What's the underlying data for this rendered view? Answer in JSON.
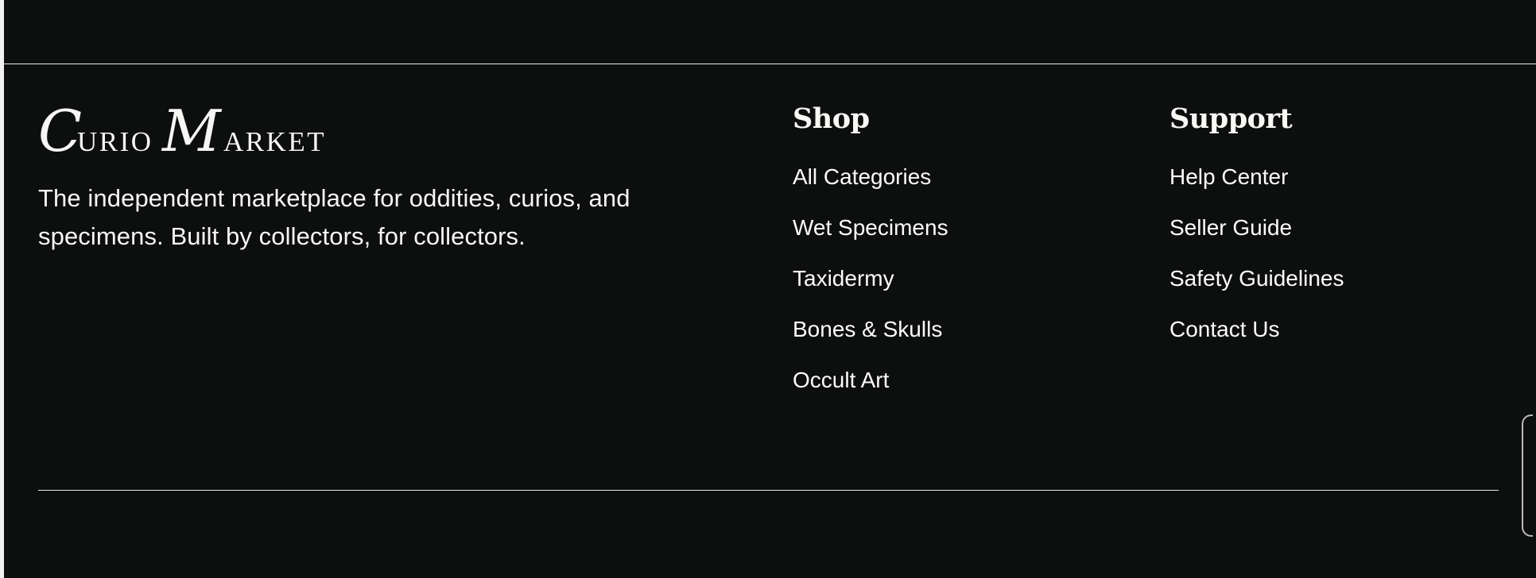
{
  "brand": {
    "name": "Curio Market",
    "logo_initial_1": "C",
    "logo_rest_1": "URIO",
    "logo_initial_2": "M",
    "logo_rest_2": "ARKET",
    "tagline": "The independent marketplace for oddities, curios, and specimens. Built by collectors, for collectors."
  },
  "columns": {
    "shop": {
      "title": "Shop",
      "links": [
        "All Categories",
        "Wet Specimens",
        "Taxidermy",
        "Bones & Skulls",
        "Occult Art"
      ]
    },
    "support": {
      "title": "Support",
      "links": [
        "Help Center",
        "Seller Guide",
        "Safety Guidelines",
        "Contact Us"
      ]
    }
  },
  "colors": {
    "background": "#0d0f0e",
    "text": "#f4f4f2",
    "rule": "#e8e8e8"
  }
}
